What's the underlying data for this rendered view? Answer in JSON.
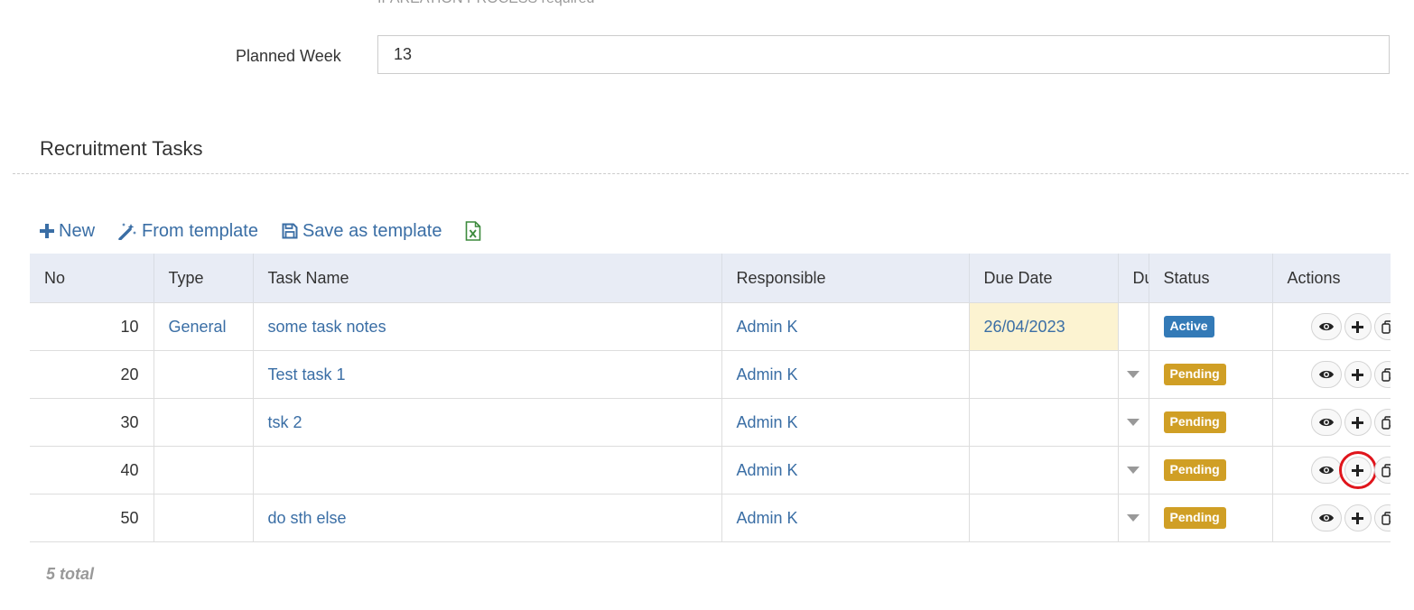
{
  "form": {
    "top_cut_text": "IPAREATION PROCESS required",
    "planned_week_label": "Planned Week",
    "planned_week_value": "13"
  },
  "section": {
    "title": "Recruitment Tasks"
  },
  "toolbar": {
    "new_label": "New",
    "from_template_label": "From template",
    "save_template_label": "Save as template",
    "excel_icon": "excel-export-icon"
  },
  "table": {
    "headers": {
      "no": "No",
      "type": "Type",
      "task_name": "Task Name",
      "responsible": "Responsible",
      "due_date": "Due Date",
      "du": "Du",
      "status": "Status",
      "actions": "Actions"
    },
    "rows": [
      {
        "no": "10",
        "type": "General",
        "task_name": "some task notes",
        "responsible": "Admin K",
        "due_date": "26/04/2023",
        "due_highlight": true,
        "has_caret": false,
        "status": "Active",
        "status_kind": "active"
      },
      {
        "no": "20",
        "type": "",
        "task_name": "Test task 1",
        "responsible": "Admin K",
        "due_date": "",
        "due_highlight": false,
        "has_caret": true,
        "status": "Pending",
        "status_kind": "pending"
      },
      {
        "no": "30",
        "type": "",
        "task_name": "tsk 2",
        "responsible": "Admin K",
        "due_date": "",
        "due_highlight": false,
        "has_caret": true,
        "status": "Pending",
        "status_kind": "pending"
      },
      {
        "no": "40",
        "type": "",
        "task_name": "",
        "responsible": "Admin K",
        "due_date": "",
        "due_highlight": false,
        "has_caret": true,
        "status": "Pending",
        "status_kind": "pending",
        "add_highlighted": true
      },
      {
        "no": "50",
        "type": "",
        "task_name": "do sth else",
        "responsible": "Admin K",
        "due_date": "",
        "due_highlight": false,
        "has_caret": true,
        "status": "Pending",
        "status_kind": "pending"
      }
    ]
  },
  "footer": {
    "total": "5 total"
  },
  "colors": {
    "link": "#3a6ea5",
    "header_bg": "#e8ecf5",
    "active": "#337ab7",
    "pending": "#d09f25",
    "due_highlight": "#fcf3d1",
    "highlight_box": "#e0151c"
  }
}
